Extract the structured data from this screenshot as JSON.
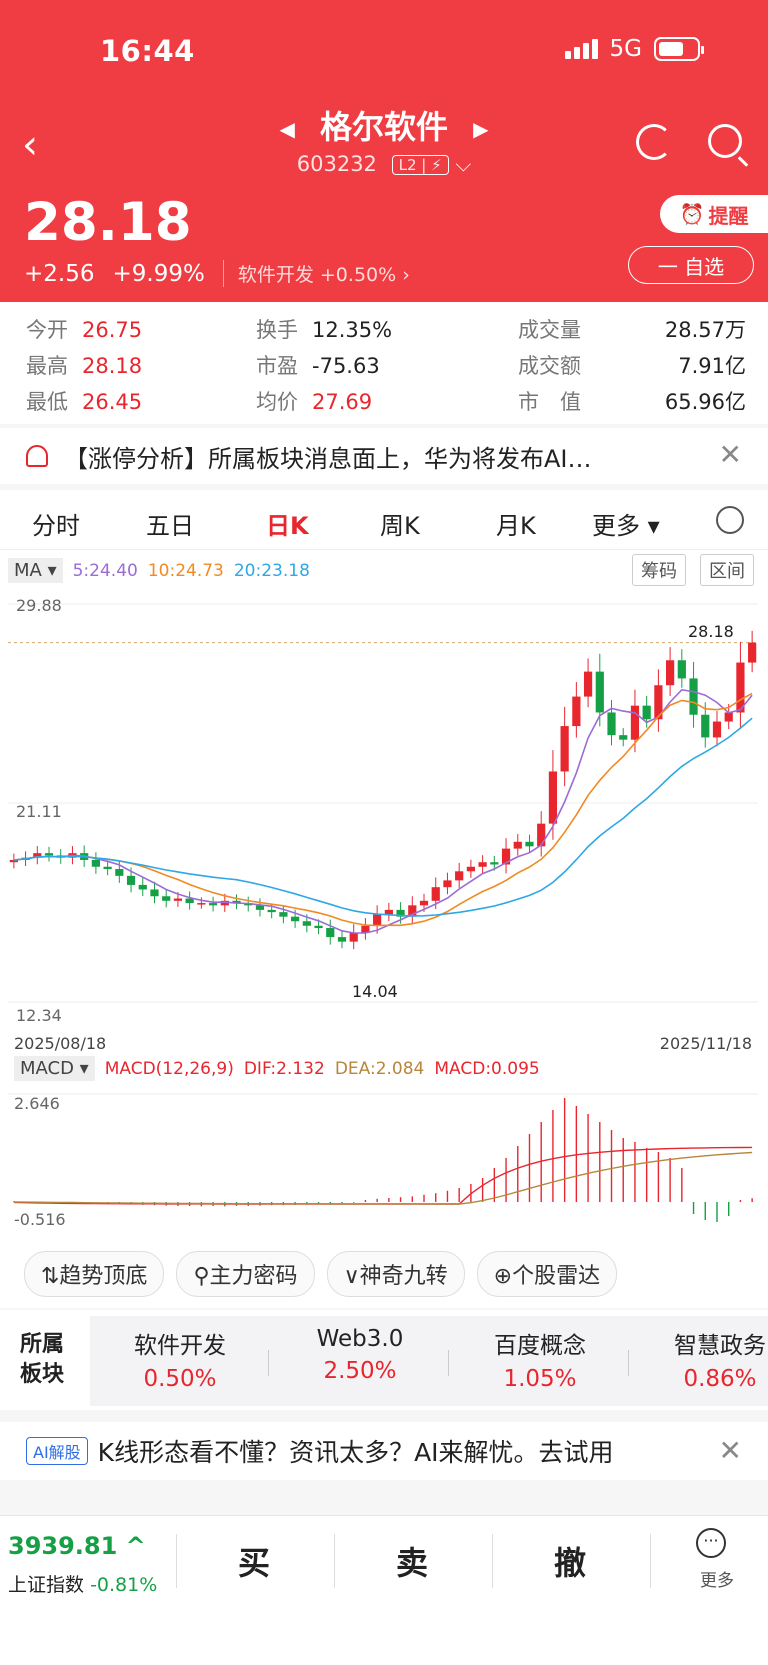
{
  "status": {
    "time": "16:44",
    "network": "5G"
  },
  "stock": {
    "name": "格尔软件",
    "code": "603232",
    "level_badge": "L2 | ⚡",
    "price": "28.18",
    "change": "+2.56",
    "change_pct": "+9.99%",
    "sector": "软件开发",
    "sector_pct": "+0.50%",
    "alert_label": "提醒",
    "fav_label": "一 自选"
  },
  "quote": {
    "open_label": "今开",
    "open": "26.75",
    "high_label": "最高",
    "high": "28.18",
    "low_label": "最低",
    "low": "26.45",
    "turnover_label": "换手",
    "turnover": "12.35%",
    "pe_label": "市盈",
    "pe": "-75.63",
    "avg_label": "均价",
    "avg": "27.69",
    "volume_label": "成交量",
    "volume": "28.57万",
    "amount_label": "成交额",
    "amount": "7.91亿",
    "mktcap_label": "市　值",
    "mktcap": "65.96亿"
  },
  "news": {
    "text": "【涨停分析】所属板块消息面上，华为将发布AI…"
  },
  "tabs": [
    "分时",
    "五日",
    "日K",
    "周K",
    "月K",
    "更多 ▾"
  ],
  "chart_data": {
    "type": "candlestick",
    "ma_box": "MA ▾",
    "ma5": "5:24.40",
    "ma10": "10:24.73",
    "ma20": "20:23.18",
    "chip_btn": "筹码",
    "range_btn": "区间",
    "y_top": "29.88",
    "y_mid": "21.11",
    "y_bottom": "12.34",
    "high_mark": "28.18",
    "low_mark": "14.04",
    "x_start": "2025/08/18",
    "x_end": "2025/11/18",
    "macd_box": "MACD ▾",
    "macd_params": "MACD(12,26,9)",
    "dif": "DIF:2.132",
    "dea": "DEA:2.084",
    "macd": "MACD:0.095",
    "macd_top": "2.646",
    "macd_bottom": "-0.516",
    "ylim": [
      12.34,
      29.88
    ],
    "closes": [
      18.6,
      18.7,
      18.9,
      18.8,
      18.7,
      18.9,
      18.6,
      18.3,
      18.2,
      17.9,
      17.5,
      17.3,
      17.0,
      16.8,
      16.9,
      16.7,
      16.7,
      16.6,
      16.8,
      16.7,
      16.6,
      16.4,
      16.3,
      16.1,
      15.9,
      15.7,
      15.6,
      15.2,
      15.0,
      15.4,
      15.7,
      16.2,
      16.4,
      16.1,
      16.6,
      16.8,
      17.4,
      17.7,
      18.1,
      18.3,
      18.5,
      18.4,
      19.1,
      19.4,
      19.2,
      20.2,
      22.5,
      24.5,
      25.8,
      26.9,
      25.1,
      24.1,
      23.9,
      25.4,
      24.8,
      26.3,
      27.4,
      26.6,
      25.0,
      24.0,
      24.7,
      25.1,
      27.3,
      28.18
    ],
    "macd_bars": [
      0.02,
      0.01,
      0.01,
      0,
      0,
      -0.01,
      0,
      0,
      -0.02,
      -0.03,
      -0.05,
      -0.07,
      -0.08,
      -0.09,
      -0.1,
      -0.1,
      -0.11,
      -0.1,
      -0.11,
      -0.1,
      -0.1,
      -0.09,
      -0.08,
      -0.08,
      -0.07,
      -0.06,
      -0.05,
      -0.04,
      -0.03,
      -0.02,
      0.05,
      0.08,
      0.1,
      0.12,
      0.14,
      0.18,
      0.22,
      0.28,
      0.35,
      0.45,
      0.6,
      0.85,
      1.1,
      1.4,
      1.7,
      2.0,
      2.3,
      2.6,
      2.4,
      2.2,
      2.0,
      1.8,
      1.6,
      1.5,
      1.35,
      1.25,
      1.1,
      0.85,
      -0.3,
      -0.45,
      -0.5,
      -0.35,
      0.05,
      0.095
    ]
  },
  "tools": [
    "⇅趋势顶底",
    "⚲主力密码",
    "∨神奇九转",
    "⊕个股雷达"
  ],
  "sectors_label": "所属板块",
  "sectors": [
    {
      "name": "软件开发",
      "pct": "0.50%"
    },
    {
      "name": "Web3.0",
      "pct": "2.50%"
    },
    {
      "name": "百度概念",
      "pct": "1.05%"
    },
    {
      "name": "智慧政务",
      "pct": "0.86%"
    }
  ],
  "ai": {
    "tag": "AI解股",
    "text": "K线形态看不懂？资讯太多？AI来解忧。去试用"
  },
  "bottom": {
    "index_value": "3939.81 ^",
    "index_name": "上证指数",
    "index_pct": "-0.81%",
    "buy": "买",
    "sell": "卖",
    "cancel": "撤",
    "more": "更多"
  },
  "colors": {
    "brand": "#ef3d43",
    "up": "#e8262e",
    "down": "#15a046"
  }
}
